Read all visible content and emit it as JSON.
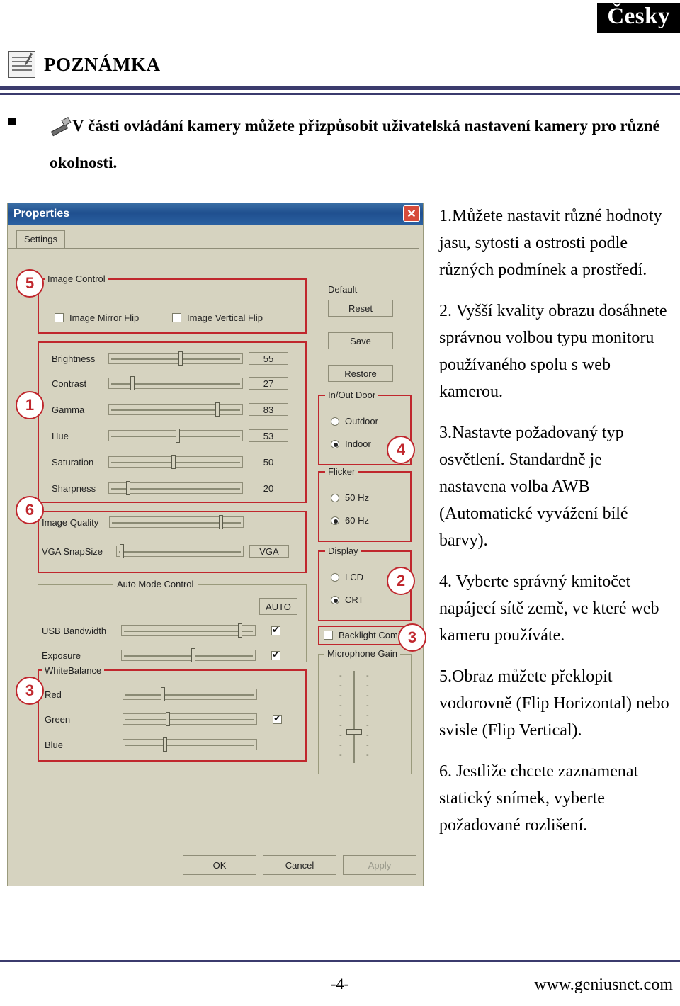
{
  "header": {
    "language_tab": "Česky",
    "note_label": "POZNÁMKA",
    "note_icon": "note-pen-icon"
  },
  "bullet": {
    "icon": "tool-settings-icon",
    "text": "V části ovládání kamery můžete přizpůsobit uživatelská nastavení kamery pro různé okolnosti."
  },
  "dialog": {
    "title": "Properties",
    "close_label": "✕",
    "tab": "Settings",
    "groups": {
      "image_control": "Image Control",
      "image_quality": "Image Quality",
      "auto_mode_control": "Auto Mode Control",
      "white_balance": "WhiteBalance",
      "in_out_door": "In/Out Door",
      "flicker": "Flicker",
      "display": "Display",
      "microphone_gain": "Microphone Gain"
    },
    "checkboxes": [
      {
        "label": "Image Mirror Flip",
        "checked": false
      },
      {
        "label": "Image Vertical Flip",
        "checked": false
      }
    ],
    "sliders": [
      {
        "label": "Brightness",
        "value": "55",
        "pos": 52
      },
      {
        "label": "Contrast",
        "value": "27",
        "pos": 16
      },
      {
        "label": "Gamma",
        "value": "83",
        "pos": 80
      },
      {
        "label": "Hue",
        "value": "53",
        "pos": 50
      },
      {
        "label": "Saturation",
        "value": "50",
        "pos": 47
      },
      {
        "label": "Sharpness",
        "value": "20",
        "pos": 13
      }
    ],
    "quality_sliders": [
      {
        "label": "Image Quality",
        "pos": 82
      },
      {
        "label": "VGA SnapSize",
        "value": "VGA",
        "pos": 2
      }
    ],
    "auto_mode": {
      "button": "AUTO",
      "rows": [
        {
          "label": "USB Bandwidth",
          "pos": 87,
          "checked": true
        },
        {
          "label": "Exposure",
          "pos": 52,
          "checked": true
        }
      ]
    },
    "white_balance_rows": [
      {
        "label": "Red",
        "pos": 28,
        "checked": false
      },
      {
        "label": "Green",
        "pos": 32,
        "checked": true
      },
      {
        "label": "Blue",
        "pos": 30,
        "checked": false
      }
    ],
    "right_buttons": [
      {
        "label": "Default",
        "enabled": true
      },
      {
        "label": "Reset",
        "enabled": true
      },
      {
        "label": "Save",
        "enabled": true
      },
      {
        "label": "Restore",
        "enabled": true
      }
    ],
    "in_out_door": [
      {
        "label": "Outdoor",
        "selected": false
      },
      {
        "label": "Indoor",
        "selected": true
      }
    ],
    "flicker": [
      {
        "label": "50 Hz",
        "selected": false
      },
      {
        "label": "60 Hz",
        "selected": true
      }
    ],
    "display": [
      {
        "label": "LCD",
        "selected": false
      },
      {
        "label": "CRT",
        "selected": true
      }
    ],
    "backlight_comp": {
      "label": "Backlight Comp",
      "checked": false
    },
    "bottom_buttons": [
      {
        "label": "OK",
        "enabled": true
      },
      {
        "label": "Cancel",
        "enabled": true
      },
      {
        "label": "Apply",
        "enabled": false
      }
    ],
    "callouts": [
      "5",
      "1",
      "6",
      "3",
      "4",
      "2",
      "3"
    ]
  },
  "instructions": [
    "1.Můžete nastavit různé hodnoty jasu, sytosti a ostrosti podle různých podmínek a prostředí.",
    "2. Vyšší kvality obrazu dosáhnete správnou volbou typu monitoru používaného spolu s web kamerou.",
    "3.Nastavte požadovaný typ osvětlení. Standardně je nastavena volba AWB (Automatické vyvážení bílé barvy).",
    "4. Vyberte správný kmitočet napájecí sítě země, ve které web kameru používáte.",
    "5.Obraz můžete překlopit vodorovně (Flip Horizontal) nebo svisle (Flip Vertical).",
    "6. Jestliže chcete zaznamenat statický snímek, vyberte požadované rozlišení."
  ],
  "footer": {
    "page": "-4-",
    "url": "www.geniusnet.com"
  }
}
